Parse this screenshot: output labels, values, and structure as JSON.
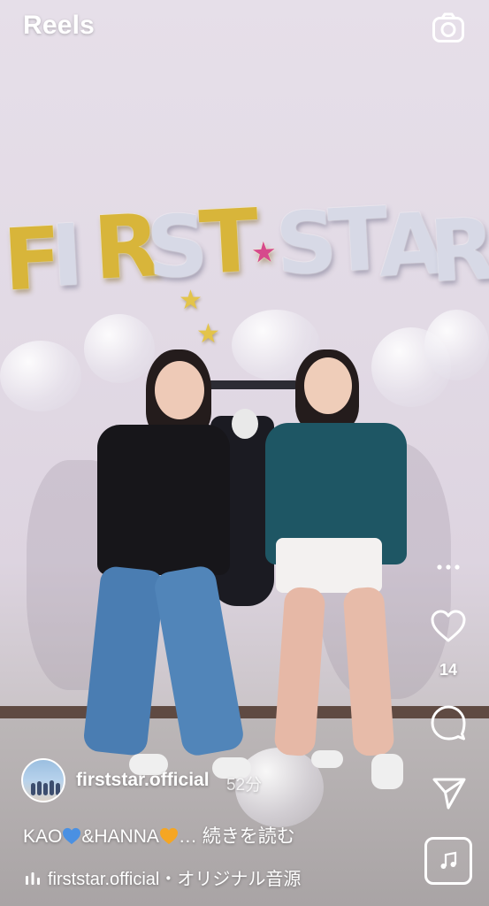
{
  "header": {
    "title": "Reels",
    "camera_icon": "camera-icon"
  },
  "actions": {
    "more_icon": "more-dots-icon",
    "like_icon": "heart-icon",
    "like_count": "14",
    "comment_icon": "comment-bubble-icon",
    "share_icon": "paper-plane-icon",
    "audio_icon": "music-note-icon"
  },
  "post": {
    "username": "firststar.official",
    "time_ago": "52分",
    "caption_part1": "KAO",
    "caption_part2": "&HANNA",
    "caption_ellipsis": "…",
    "caption_more": "続きを読む",
    "heart_blue": "#4a90e2",
    "heart_orange": "#f5a623"
  },
  "audio": {
    "artist": "firststar.official",
    "separator": "・",
    "track": "オリジナル音源"
  },
  "video": {
    "balloon_letters": [
      "F",
      "I",
      "R",
      "S",
      "T",
      "★",
      "S",
      "T",
      "A",
      "R"
    ]
  }
}
